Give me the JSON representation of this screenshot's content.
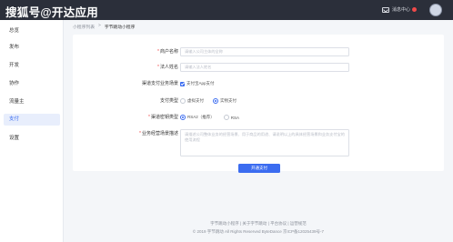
{
  "header": {
    "brand": "搜狐号@开达应用",
    "messages_label": "消息中心"
  },
  "sidebar": {
    "items": [
      {
        "label": "总览"
      },
      {
        "label": "发布"
      },
      {
        "label": "开发"
      },
      {
        "label": "协作"
      },
      {
        "label": "流量主"
      },
      {
        "label": "支付"
      },
      {
        "label": "设置"
      }
    ],
    "active_index": 5
  },
  "breadcrumb": {
    "parent": "小程序列表",
    "separator": ">",
    "current": "字节跳动小程序"
  },
  "form": {
    "merchant_name": {
      "label": "商户名称",
      "placeholder": "请输入公司主体的全称"
    },
    "contact_name": {
      "label": "法人姓名",
      "placeholder": "请输入法人姓名"
    },
    "channel_scene": {
      "label": "渠道支付业务场景",
      "option": "支付宝App支付"
    },
    "pay_type": {
      "label": "支付类型",
      "options": [
        "虚拟支付",
        "实物支付"
      ],
      "selected": 1
    },
    "sign_type": {
      "label": "渠道密钥类型",
      "options": [
        "RSA2（推荐）",
        "RSA"
      ],
      "selected": 0
    },
    "business_desc": {
      "label": "业务经营场景描述",
      "placeholder": "请描述公司整体业务的经营场景、用于商品的用途、请说明以上的具体经营场景和业务支付宝的使用流程"
    },
    "submit_label": "开通支付"
  },
  "footer": {
    "links": "字节跳动小程序 | 关于字节跳动 | 平台协议 | 运营规范",
    "copyright": "© 2019 字节跳动 All Rights Reserved ByteDance 京ICP备12025439号-7"
  }
}
